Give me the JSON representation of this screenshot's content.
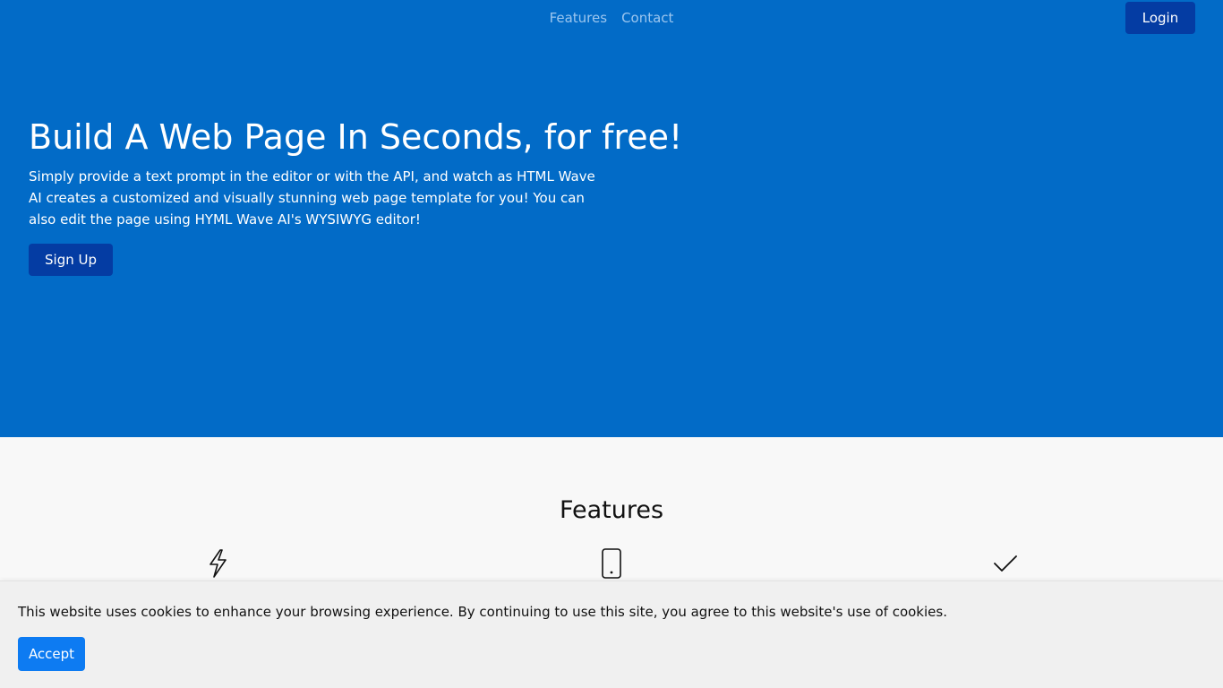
{
  "nav": {
    "links": [
      "Features",
      "Contact"
    ],
    "login_label": "Login"
  },
  "hero": {
    "title": "Build A Web Page In Seconds, for free!",
    "description": "Simply provide a text prompt in the editor or with the API, and watch as HTML Wave AI creates a customized and visually stunning web page template for you! You can also edit the page using HYML Wave AI's WYSIWYG editor!",
    "signup_label": "Sign Up"
  },
  "features": {
    "heading": "Features",
    "icons": [
      "lightning-icon",
      "smartphone-icon",
      "checkmark-icon"
    ]
  },
  "cookie_banner": {
    "text": "This website uses cookies to enhance your browsing experience. By continuing to use this site, you agree to this website's use of cookies.",
    "accept_label": "Accept"
  },
  "colors": {
    "hero_background": "#026bc7",
    "button_dark_blue": "#043ca3",
    "accept_button": "#0d7bf2",
    "nav_link": "#9cc6ef"
  }
}
